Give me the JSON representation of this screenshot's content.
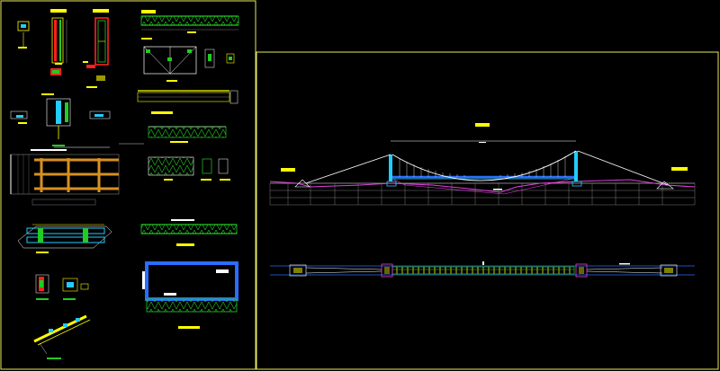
{
  "drawing": {
    "background": "#000000",
    "frame_color": "#e8e85a",
    "colors": {
      "yellow": "#ffff00",
      "green": "#22cc22",
      "red": "#ff2020",
      "cyan": "#22ccff",
      "blue": "#2a6dff",
      "orange": "#d89020",
      "magenta": "#e040e0",
      "white": "#ffffff",
      "gray": "#9a9a9a"
    }
  },
  "sheets": [
    {
      "name": "details-sheet",
      "label": ""
    },
    {
      "name": "bridge-sheet",
      "label": ""
    }
  ],
  "views": [
    {
      "name": "steel-plate-detail"
    },
    {
      "name": "column-section-detail"
    },
    {
      "name": "top-truss-elevation"
    },
    {
      "name": "truss-panel-detail"
    },
    {
      "name": "cross-beam-detail"
    },
    {
      "name": "bolt-connection-detail"
    },
    {
      "name": "deck-plan-detail"
    },
    {
      "name": "bottom-truss-elevation"
    },
    {
      "name": "anchor-block-detail"
    },
    {
      "name": "frame-cross-section"
    },
    {
      "name": "isometric-deck-detail"
    },
    {
      "name": "suspension-bridge-elevation"
    },
    {
      "name": "suspension-bridge-plan"
    }
  ]
}
